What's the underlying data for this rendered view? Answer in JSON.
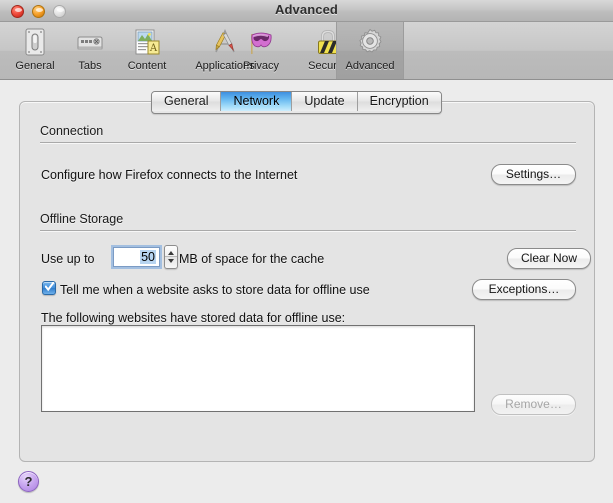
{
  "window": {
    "title": "Advanced",
    "controls": [
      {
        "name": "close",
        "label": "Close"
      },
      {
        "name": "minimize",
        "label": "Minimize"
      },
      {
        "name": "zoom",
        "label": "Zoom"
      }
    ]
  },
  "toolbar": {
    "items": [
      {
        "id": "general",
        "label": "General",
        "icon": "switch-icon",
        "selected": false
      },
      {
        "id": "tabs",
        "label": "Tabs",
        "icon": "tabs-icon",
        "selected": false
      },
      {
        "id": "content",
        "label": "Content",
        "icon": "content-icon",
        "selected": false
      },
      {
        "id": "applications",
        "label": "Applications",
        "icon": "applications-icon",
        "selected": false
      },
      {
        "id": "privacy",
        "label": "Privacy",
        "icon": "mask-icon",
        "selected": false
      },
      {
        "id": "security",
        "label": "Security",
        "icon": "padlock-icon",
        "selected": false
      },
      {
        "id": "advanced",
        "label": "Advanced",
        "icon": "gear-icon",
        "selected": true
      }
    ]
  },
  "tabs": [
    {
      "id": "general",
      "label": "General",
      "active": false
    },
    {
      "id": "network",
      "label": "Network",
      "active": true
    },
    {
      "id": "update",
      "label": "Update",
      "active": false
    },
    {
      "id": "encryption",
      "label": "Encryption",
      "active": false
    }
  ],
  "network": {
    "connection": {
      "heading": "Connection",
      "description": "Configure how Firefox connects to the Internet",
      "settings_button": "Settings…"
    },
    "offline_storage": {
      "heading": "Offline Storage",
      "use_up_to_label": "Use up to",
      "cache_size_value": "50",
      "cache_units_label": "MB of space for the cache",
      "clear_now_button": "Clear Now",
      "notify_checkbox_label": "Tell me when a website asks to store data for offline use",
      "notify_checked": true,
      "exceptions_button": "Exceptions…",
      "stored_sites_label": "The following websites have stored data for offline use:",
      "stored_sites": [],
      "remove_button": "Remove…",
      "remove_disabled": true
    }
  },
  "help": {
    "label": "?"
  },
  "colors": {
    "accent_blue": "#3f8ddb",
    "tab_active_top": "#3e8fe0",
    "tab_active_bottom": "#cdeefd",
    "window_bg": "#ebebeb",
    "panel_bg": "#e4e4e4",
    "help_purple": "#ab80e0"
  }
}
